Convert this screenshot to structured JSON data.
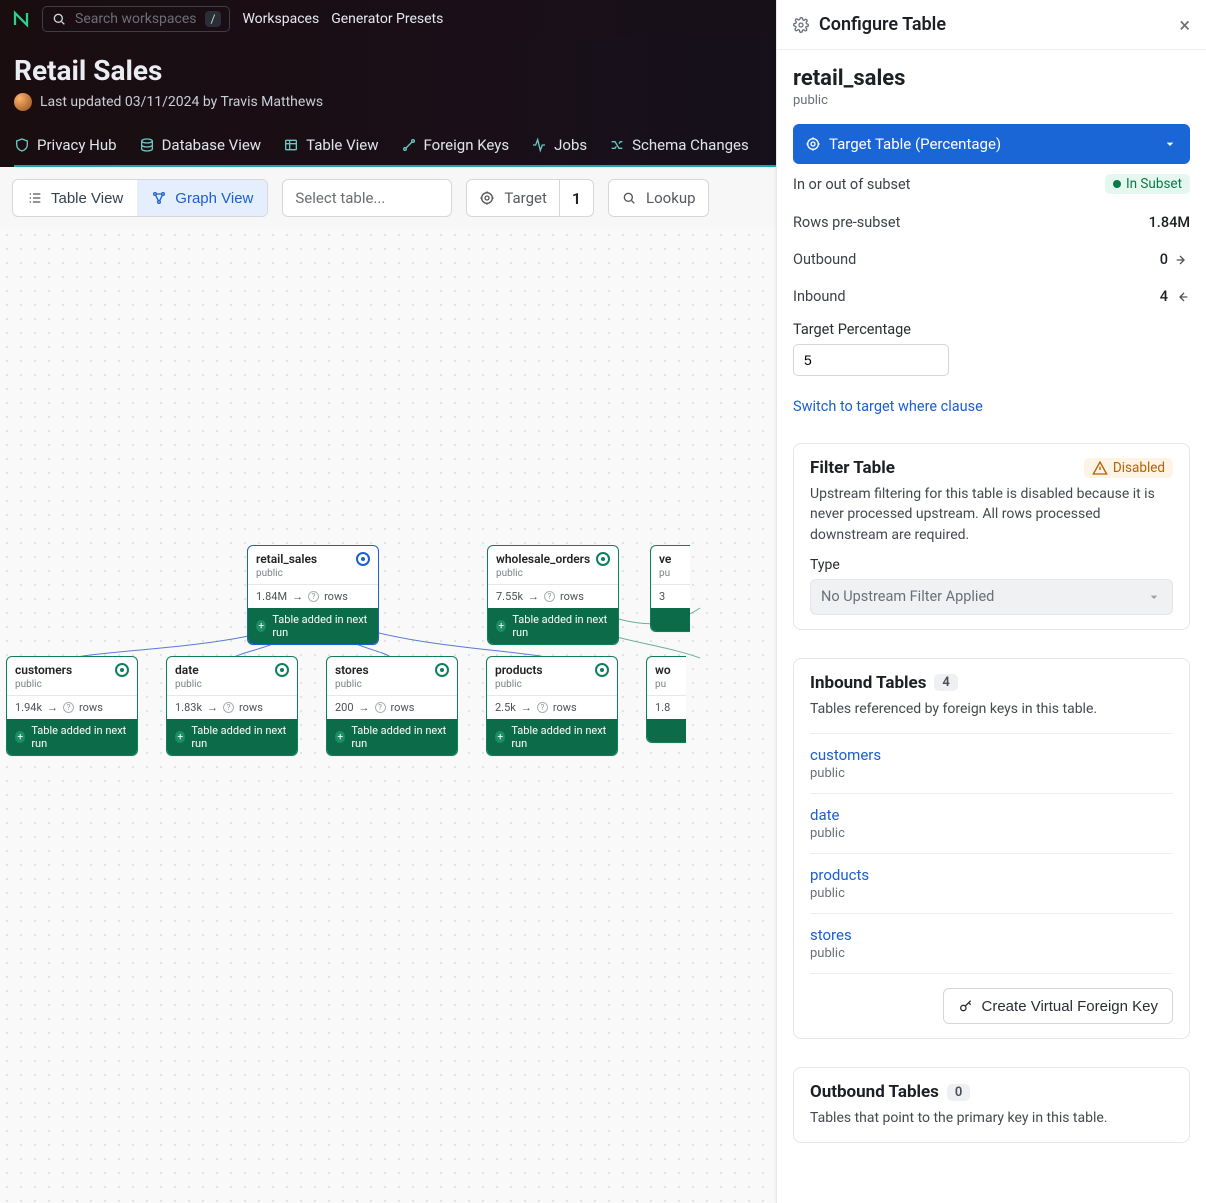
{
  "topbar": {
    "search_placeholder": "Search workspaces",
    "slash": "/",
    "nav": {
      "workspaces": "Workspaces",
      "presets": "Generator Presets"
    }
  },
  "header": {
    "title": "Retail Sales",
    "meta": "Last updated 03/11/2024 by Travis Matthews",
    "tabs": {
      "privacy": "Privacy Hub",
      "database": "Database View",
      "table": "Table View",
      "fk": "Foreign Keys",
      "jobs": "Jobs",
      "schema": "Schema Changes"
    }
  },
  "toolbar": {
    "table_view": "Table View",
    "graph_view": "Graph View",
    "select_placeholder": "Select table...",
    "target_label": "Target",
    "target_count": "1",
    "lookup": "Lookup"
  },
  "graph": {
    "added_footer": "Table added in next run",
    "nodes": {
      "retail_sales": {
        "name": "retail_sales",
        "schema": "public",
        "rows": "1.84M",
        "rows_suffix": "rows"
      },
      "wholesale_orders": {
        "name": "wholesale_orders",
        "schema": "public",
        "rows": "7.55k",
        "rows_suffix": "rows"
      },
      "vendors": {
        "name": "ve",
        "schema": "pu",
        "rows": "3"
      },
      "customers": {
        "name": "customers",
        "schema": "public",
        "rows": "1.94k",
        "rows_suffix": "rows"
      },
      "date": {
        "name": "date",
        "schema": "public",
        "rows": "1.83k",
        "rows_suffix": "rows"
      },
      "stores": {
        "name": "stores",
        "schema": "public",
        "rows": "200",
        "rows_suffix": "rows"
      },
      "products": {
        "name": "products",
        "schema": "public",
        "rows": "2.5k",
        "rows_suffix": "rows"
      },
      "wo_child": {
        "name": "wo",
        "schema": "pu",
        "rows": "1.8"
      }
    }
  },
  "panel": {
    "title": "Configure Table",
    "table_name": "retail_sales",
    "schema": "public",
    "target_bar": "Target Table (Percentage)",
    "kv": {
      "subset_label": "In or out of subset",
      "subset_badge": "In Subset",
      "rows_label": "Rows pre-subset",
      "rows_value": "1.84M",
      "out_label": "Outbound",
      "out_value": "0",
      "in_label": "Inbound",
      "in_value": "4"
    },
    "target_pct_label": "Target Percentage",
    "target_pct_value": "5",
    "switch_link": "Switch to target where clause",
    "filter": {
      "title": "Filter Table",
      "disabled_badge": "Disabled",
      "desc": "Upstream filtering for this table is disabled because it is never processed upstream. All rows processed downstream are required.",
      "type_label": "Type",
      "type_value": "No Upstream Filter Applied"
    },
    "inbound": {
      "title": "Inbound Tables",
      "count": "4",
      "desc": "Tables referenced by foreign keys in this table.",
      "items": [
        {
          "name": "customers",
          "schema": "public"
        },
        {
          "name": "date",
          "schema": "public"
        },
        {
          "name": "products",
          "schema": "public"
        },
        {
          "name": "stores",
          "schema": "public"
        }
      ],
      "vfk_button": "Create Virtual Foreign Key"
    },
    "outbound": {
      "title": "Outbound Tables",
      "count": "0",
      "desc": "Tables that point to the primary key in this table."
    }
  }
}
